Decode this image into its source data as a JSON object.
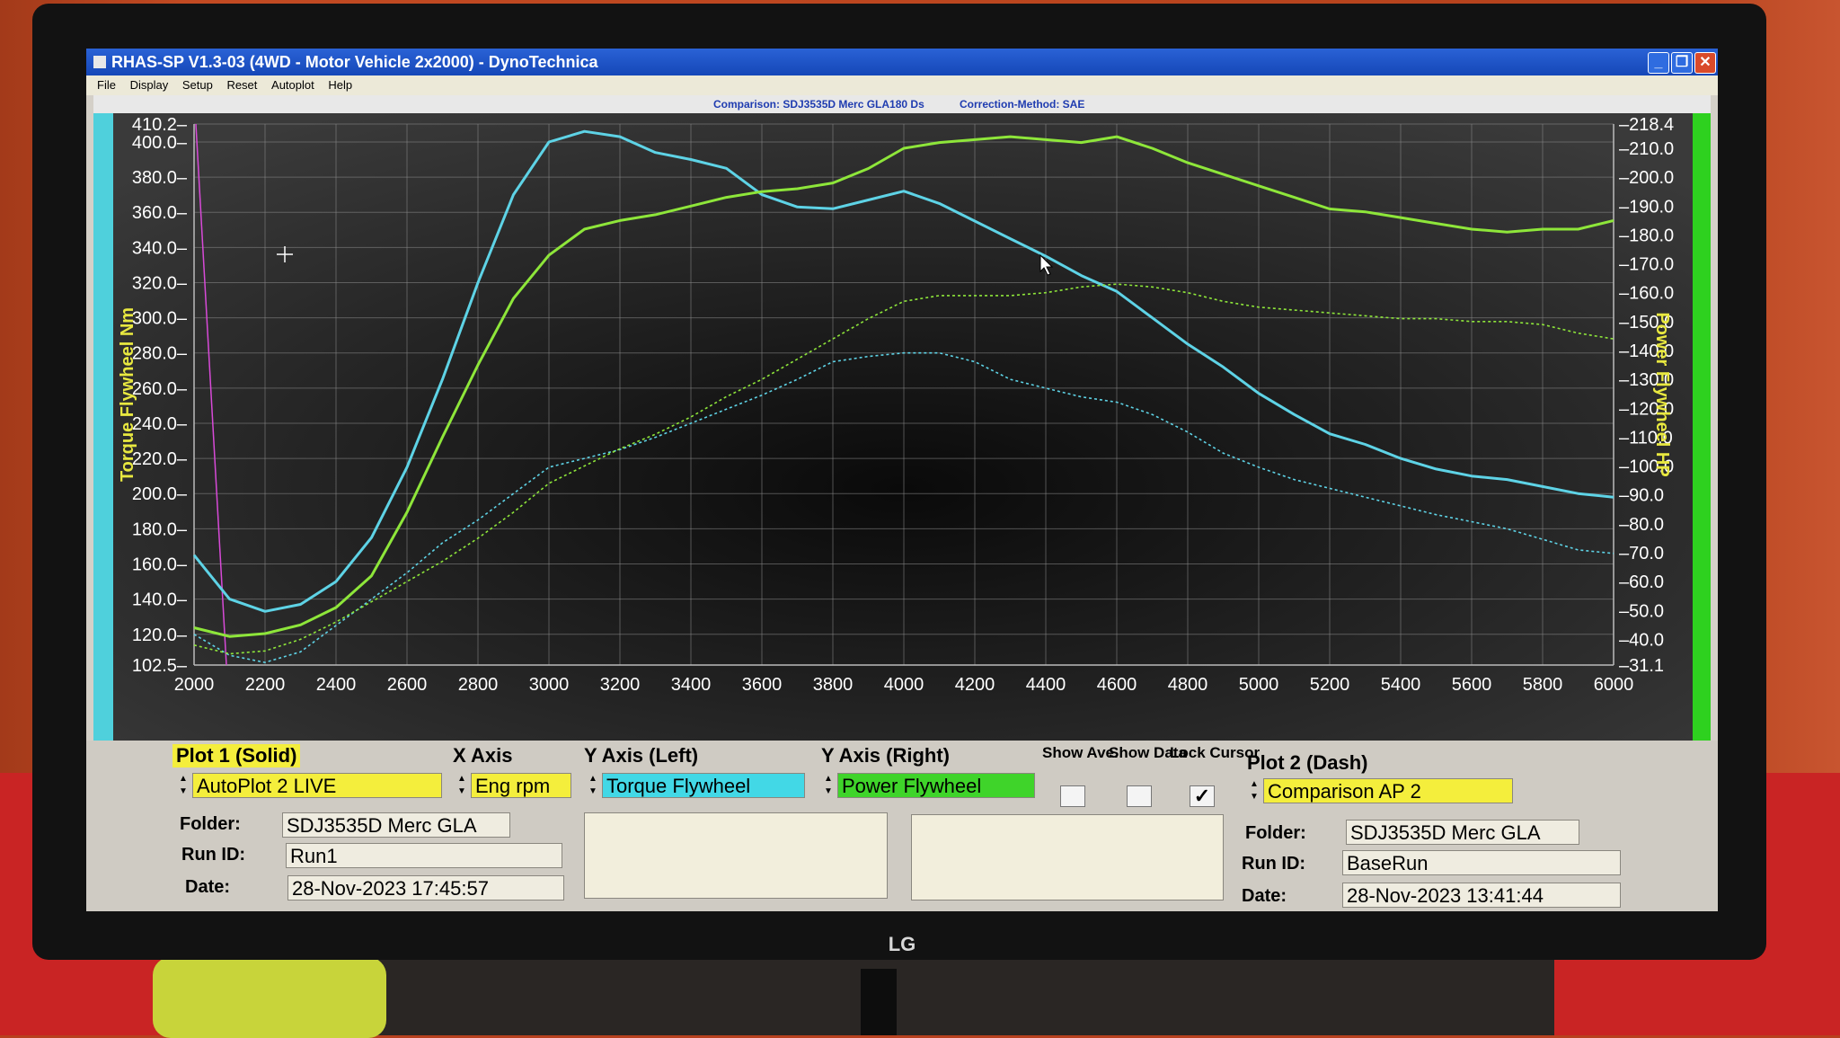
{
  "window": {
    "title": "RHAS-SP V1.3-03  (4WD - Motor Vehicle 2x2000) - DynoTechnica",
    "min_btn": "_",
    "max_btn": "❐",
    "close_btn": "✕"
  },
  "menu": [
    "File",
    "Display",
    "Setup",
    "Reset",
    "Autoplot",
    "Help"
  ],
  "comparison_bar": {
    "comparison": "Comparison: SDJ3535D Merc GLA180 Ds",
    "correction": "Correction-Method: SAE"
  },
  "chart_data": {
    "type": "line",
    "ylabel_left": "Torque Flywheel Nm",
    "ylabel_right": "Power Flywheel HP",
    "x_ticks": [
      2000,
      2200,
      2400,
      2600,
      2800,
      3000,
      3200,
      3400,
      3600,
      3800,
      4000,
      4200,
      4400,
      4600,
      4800,
      5000,
      5200,
      5400,
      5600,
      5800,
      6000
    ],
    "xlim": [
      2000,
      6000
    ],
    "ylim_left": [
      102.5,
      410.2
    ],
    "ylim_right": [
      31.1,
      218.4
    ],
    "y_ticks_left": [
      "102.5",
      "120.0",
      "140.0",
      "160.0",
      "180.0",
      "200.0",
      "220.0",
      "240.0",
      "260.0",
      "280.0",
      "300.0",
      "320.0",
      "340.0",
      "360.0",
      "380.0",
      "400.0",
      "410.2"
    ],
    "y_ticks_right": [
      "31.1",
      "40.0",
      "50.0",
      "60.0",
      "70.0",
      "80.0",
      "90.0",
      "100.0",
      "110.0",
      "120.0",
      "130.0",
      "140.0",
      "150.0",
      "160.0",
      "170.0",
      "180.0",
      "190.0",
      "200.0",
      "210.0",
      "218.4"
    ],
    "grid": true,
    "colors": {
      "torque": "#5ed3e6",
      "power": "#8ee63a",
      "left_axis_label": "#e8e840",
      "right_axis_label": "#e8e840"
    },
    "series": [
      {
        "axis": "left",
        "style": "solid",
        "color": "#5ed3e6",
        "x": [
          2000,
          2100,
          2200,
          2300,
          2400,
          2500,
          2600,
          2700,
          2800,
          2900,
          3000,
          3100,
          3200,
          3300,
          3400,
          3500,
          3600,
          3700,
          3800,
          3900,
          4000,
          4100,
          4200,
          4300,
          4400,
          4500,
          4600,
          4700,
          4800,
          4900,
          5000,
          5100,
          5200,
          5300,
          5400,
          5500,
          5600,
          5700,
          5800,
          5900,
          6000
        ],
        "y": [
          165,
          140,
          133,
          137,
          150,
          175,
          215,
          265,
          320,
          370,
          400,
          406,
          403,
          394,
          390,
          385,
          370,
          363,
          362,
          367,
          372,
          365,
          355,
          345,
          335,
          324,
          315,
          300,
          285,
          272,
          257,
          245,
          234,
          228,
          220,
          214,
          210,
          208,
          204,
          200,
          198
        ]
      },
      {
        "axis": "right",
        "style": "solid",
        "color": "#8ee63a",
        "x": [
          2000,
          2100,
          2200,
          2300,
          2400,
          2500,
          2600,
          2700,
          2800,
          2900,
          3000,
          3100,
          3200,
          3300,
          3400,
          3500,
          3600,
          3700,
          3800,
          3900,
          4000,
          4100,
          4200,
          4300,
          4400,
          4500,
          4600,
          4700,
          4800,
          4900,
          5000,
          5100,
          5200,
          5300,
          5400,
          5500,
          5600,
          5700,
          5800,
          5900,
          6000
        ],
        "y": [
          44,
          41,
          42,
          45,
          51,
          62,
          84,
          110,
          135,
          158,
          173,
          182,
          185,
          187,
          190,
          193,
          195,
          196,
          198,
          203,
          210,
          212,
          213,
          214,
          213,
          212,
          214,
          210,
          205,
          201,
          197,
          193,
          189,
          188,
          186,
          184,
          182,
          181,
          182,
          182,
          185
        ]
      },
      {
        "axis": "left",
        "style": "dash",
        "color": "#5ed3e6",
        "x": [
          2000,
          2100,
          2200,
          2300,
          2400,
          2500,
          2600,
          2700,
          2800,
          2900,
          3000,
          3100,
          3200,
          3300,
          3400,
          3500,
          3600,
          3700,
          3800,
          3900,
          4000,
          4100,
          4200,
          4300,
          4400,
          4500,
          4600,
          4700,
          4800,
          4900,
          5000,
          5100,
          5200,
          5300,
          5400,
          5500,
          5600,
          5700,
          5800,
          5900,
          6000
        ],
        "y": [
          120,
          108,
          104,
          110,
          125,
          140,
          155,
          172,
          185,
          200,
          215,
          220,
          225,
          232,
          240,
          248,
          256,
          265,
          275,
          278,
          280,
          280,
          275,
          265,
          260,
          255,
          252,
          245,
          235,
          223,
          215,
          208,
          203,
          198,
          193,
          188,
          184,
          180,
          174,
          168,
          166
        ]
      },
      {
        "axis": "right",
        "style": "dash",
        "color": "#8ee63a",
        "x": [
          2000,
          2100,
          2200,
          2300,
          2400,
          2500,
          2600,
          2700,
          2800,
          2900,
          3000,
          3100,
          3200,
          3300,
          3400,
          3500,
          3600,
          3700,
          3800,
          3900,
          4000,
          4100,
          4200,
          4300,
          4400,
          4500,
          4600,
          4700,
          4800,
          4900,
          5000,
          5100,
          5200,
          5300,
          5400,
          5500,
          5600,
          5700,
          5800,
          5900,
          6000
        ],
        "y": [
          38,
          35,
          36,
          40,
          46,
          53,
          60,
          67,
          75,
          84,
          94,
          100,
          106,
          111,
          117,
          124,
          130,
          137,
          144,
          151,
          157,
          159,
          159,
          159,
          160,
          162,
          163,
          162,
          160,
          157,
          155,
          154,
          153,
          152,
          151,
          151,
          150,
          150,
          149,
          146,
          144
        ]
      }
    ]
  },
  "panel": {
    "plot1_title": "Plot 1 (Solid)",
    "plot1_value": "AutoPlot 2 LIVE",
    "x_axis_title": "X Axis",
    "x_axis_value": "Eng rpm",
    "y_left_title": "Y Axis (Left)",
    "y_left_value": "Torque Flywheel",
    "y_right_title": "Y Axis (Right)",
    "y_right_value": "Power Flywheel",
    "show_ave": "Show Ave.",
    "show_data": "Show Data",
    "lock_cursor": "Lock Cursor",
    "lock_cursor_checked": "✓",
    "plot2_title": "Plot 2 (Dash)",
    "plot2_value": "Comparison AP 2",
    "folder_label": "Folder:",
    "runid_label": "Run ID:",
    "date_label": "Date:",
    "plot1_folder": "SDJ3535D Merc GLA",
    "plot1_runid": "Run1",
    "plot1_date": "28-Nov-2023  17:45:57",
    "plot2_folder": "SDJ3535D Merc GLA",
    "plot2_runid": "BaseRun",
    "plot2_date": "28-Nov-2023  13:41:44"
  },
  "monitor_brand": "LG"
}
